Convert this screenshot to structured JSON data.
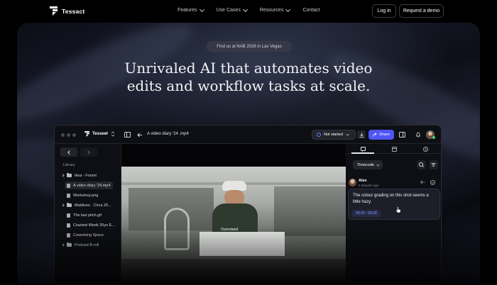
{
  "brand": {
    "name": "Tessact"
  },
  "nav": {
    "links": [
      {
        "label": "Features"
      },
      {
        "label": "Use Cases"
      },
      {
        "label": "Resources"
      },
      {
        "label": "Contact"
      }
    ],
    "login_label": "Log in",
    "demo_label": "Request  a demo"
  },
  "hero": {
    "badge": "Find us at NAB 2026 in Las Vegas",
    "headline_line1": "Unrivaled AI that automates video",
    "headline_line2": "edits and workflow tasks at scale."
  },
  "app": {
    "workspace": "Tesseet",
    "file_title": "A video diary '24 .mp4",
    "status_label": "Not started",
    "share_label": "Share",
    "sidebar": {
      "library_label": "Library",
      "items": [
        {
          "label": "Ikea - Forset",
          "kind": "folder"
        },
        {
          "label": "A video diary '24.mp4",
          "kind": "file",
          "active": true
        },
        {
          "label": "Workshop.png",
          "kind": "file"
        },
        {
          "label": "Maldives  ·  Circa 20...",
          "kind": "folder"
        },
        {
          "label": "The last pitch.gif",
          "kind": "file"
        },
        {
          "label": "Craziest Week 26yo E...",
          "kind": "file"
        },
        {
          "label": "Coworking Space",
          "kind": "file"
        },
        {
          "label": "Podcast B-roll",
          "kind": "folder"
        }
      ]
    },
    "video": {
      "caption": "Ovenstand"
    },
    "panel": {
      "timecode_label": "Timecode",
      "comment": {
        "author": "Alex",
        "time": "2 minutes ago",
        "text": "The colour grading on this shot seems a little hazy.",
        "range": "00:15 - 00:18"
      }
    }
  },
  "colors": {
    "accent": "#4f55f5",
    "background": "#000000"
  }
}
